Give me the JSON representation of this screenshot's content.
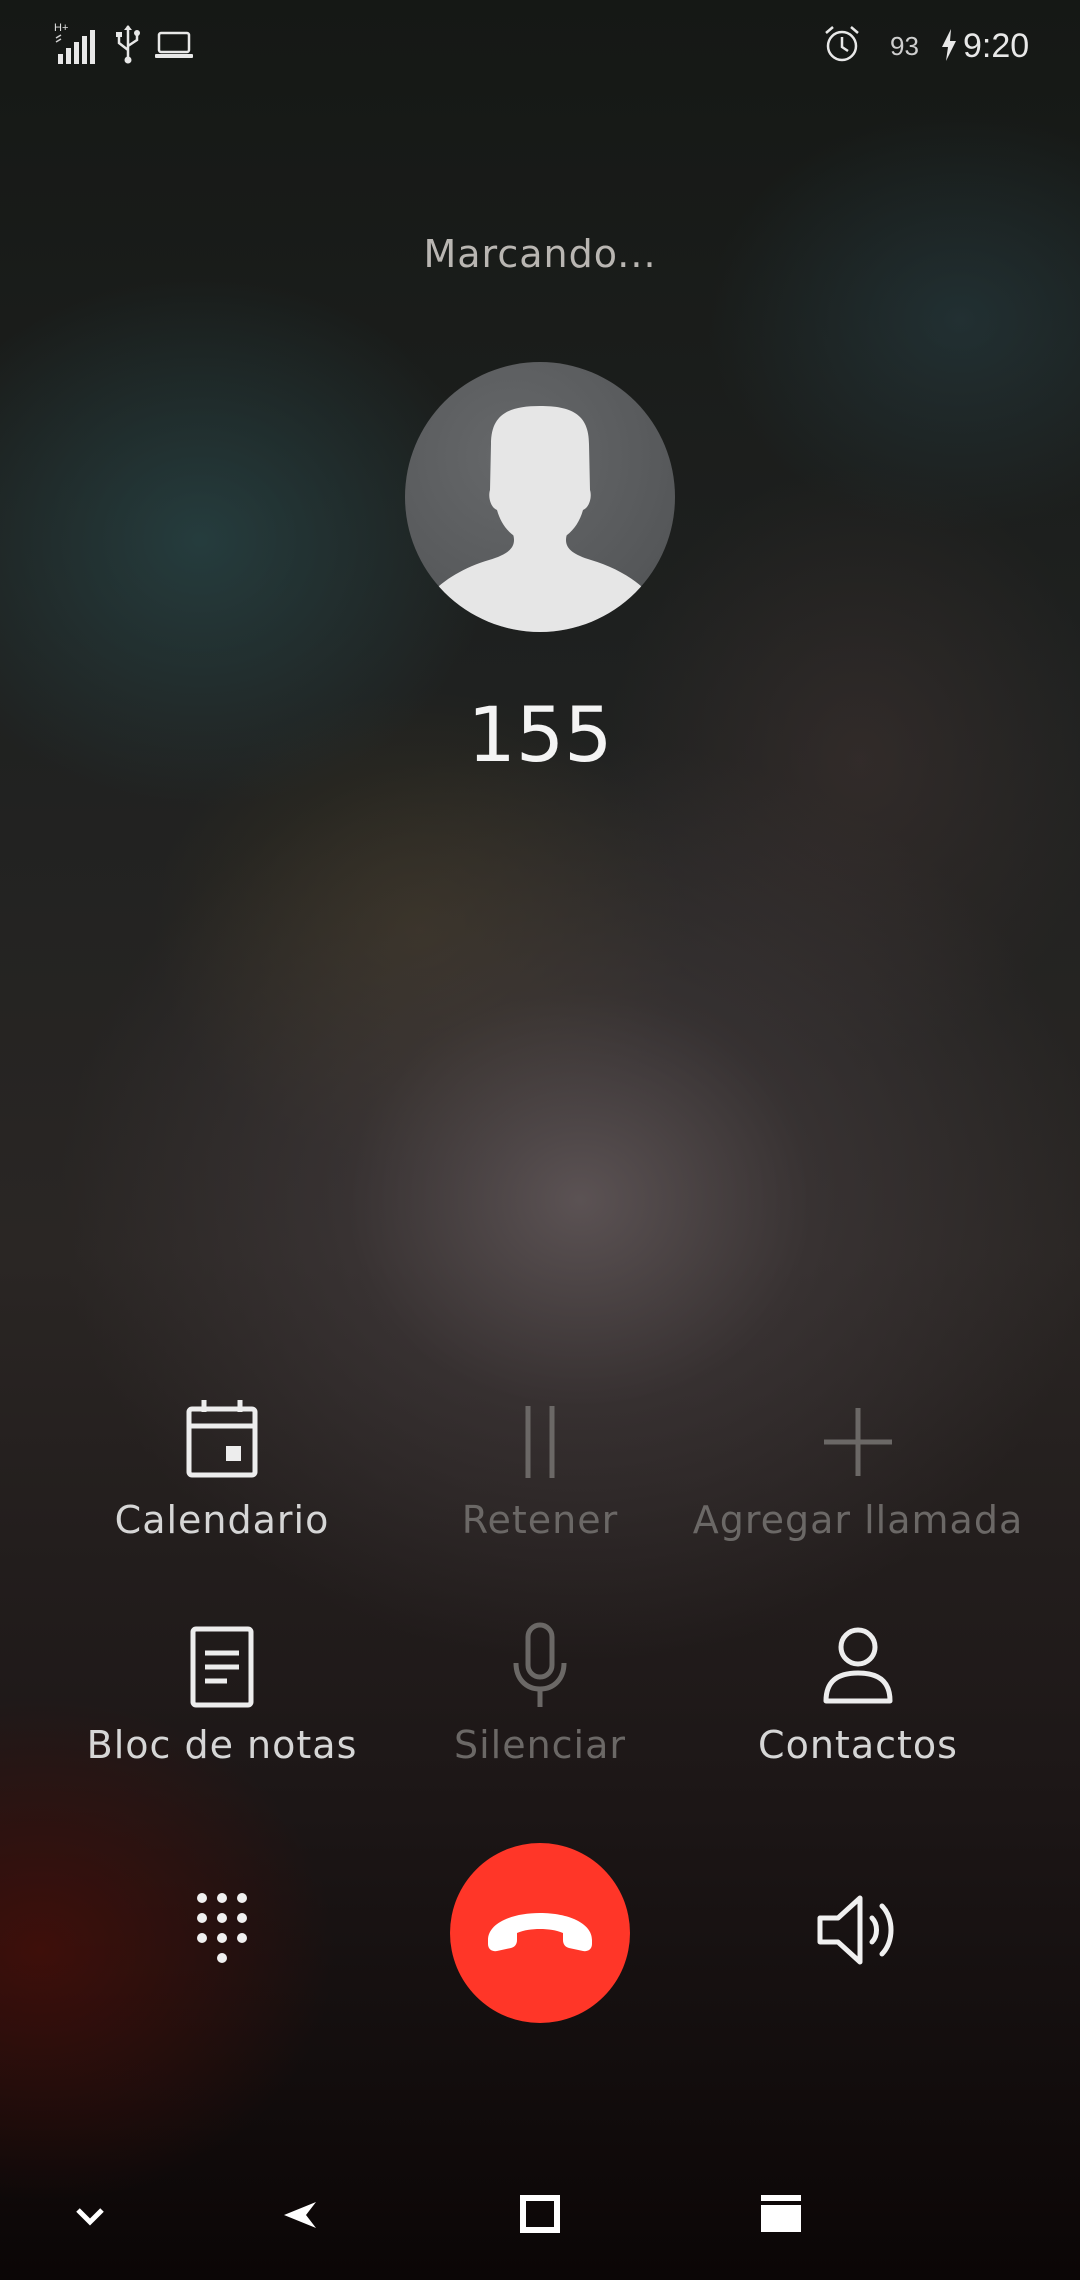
{
  "status_bar": {
    "network_type": "H+",
    "battery": "93",
    "time": "9:20",
    "icons": [
      "signal-icon",
      "usb-icon",
      "laptop-icon",
      "alarm-icon",
      "charging-icon"
    ]
  },
  "call": {
    "status": "Marcando...",
    "number": "155"
  },
  "actions": [
    {
      "label": "Calendario",
      "icon": "calendar-icon",
      "enabled": true
    },
    {
      "label": "Retener",
      "icon": "pause-icon",
      "enabled": false
    },
    {
      "label": "Agregar llamada",
      "icon": "plus-icon",
      "enabled": false
    },
    {
      "label": "Bloc de notas",
      "icon": "notepad-icon",
      "enabled": true
    },
    {
      "label": "Silenciar",
      "icon": "microphone-icon",
      "enabled": false
    },
    {
      "label": "Contactos",
      "icon": "person-icon",
      "enabled": true
    }
  ],
  "controls": {
    "dialpad": "dialpad-icon",
    "hangup": "hangup-icon",
    "speaker": "speaker-icon"
  },
  "nav_bar": [
    "chevron-down-icon",
    "back-icon",
    "home-icon",
    "recents-icon"
  ],
  "colors": {
    "hangup": "#ff3628",
    "enabled_label": "#d6d6d6",
    "disabled_label": "#6b6866"
  }
}
